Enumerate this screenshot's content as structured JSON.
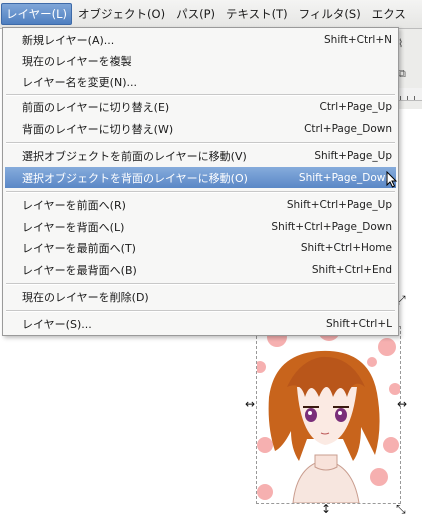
{
  "menubar": {
    "items": [
      {
        "label": "レイヤー(L)",
        "active": true
      },
      {
        "label": "オブジェクト(O)"
      },
      {
        "label": "パス(P)"
      },
      {
        "label": "テキスト(T)"
      },
      {
        "label": "フィルタ(S)"
      },
      {
        "label": "エクス"
      }
    ]
  },
  "menu": {
    "items": [
      {
        "label": "新規レイヤー(A)...",
        "shortcut": "Shift+Ctrl+N"
      },
      {
        "label": "現在のレイヤーを複製",
        "shortcut": ""
      },
      {
        "label": "レイヤー名を変更(N)...",
        "shortcut": ""
      },
      {
        "label": "前面のレイヤーに切り替え(E)",
        "shortcut": "Ctrl+Page_Up"
      },
      {
        "label": "背面のレイヤーに切り替え(W)",
        "shortcut": "Ctrl+Page_Down"
      },
      {
        "label": "選択オブジェクトを前面のレイヤーに移動(V)",
        "shortcut": "Shift+Page_Up"
      },
      {
        "label": "選択オブジェクトを背面のレイヤーに移動(O)",
        "shortcut": "Shift+Page_Down",
        "highlighted": true
      },
      {
        "label": "レイヤーを前面へ(R)",
        "shortcut": "Shift+Ctrl+Page_Up"
      },
      {
        "label": "レイヤーを背面へ(L)",
        "shortcut": "Shift+Ctrl+Page_Down"
      },
      {
        "label": "レイヤーを最前面へ(T)",
        "shortcut": "Shift+Ctrl+Home"
      },
      {
        "label": "レイヤーを最背面へ(B)",
        "shortcut": "Shift+Ctrl+End"
      },
      {
        "label": "現在のレイヤーを削除(D)",
        "shortcut": ""
      },
      {
        "label": "レイヤー(S)...",
        "shortcut": "Shift+Ctrl+L"
      }
    ]
  },
  "colors": {
    "highlight": "#5a87c6",
    "hair": "#c8641c",
    "dots": "#f2a0a0"
  }
}
